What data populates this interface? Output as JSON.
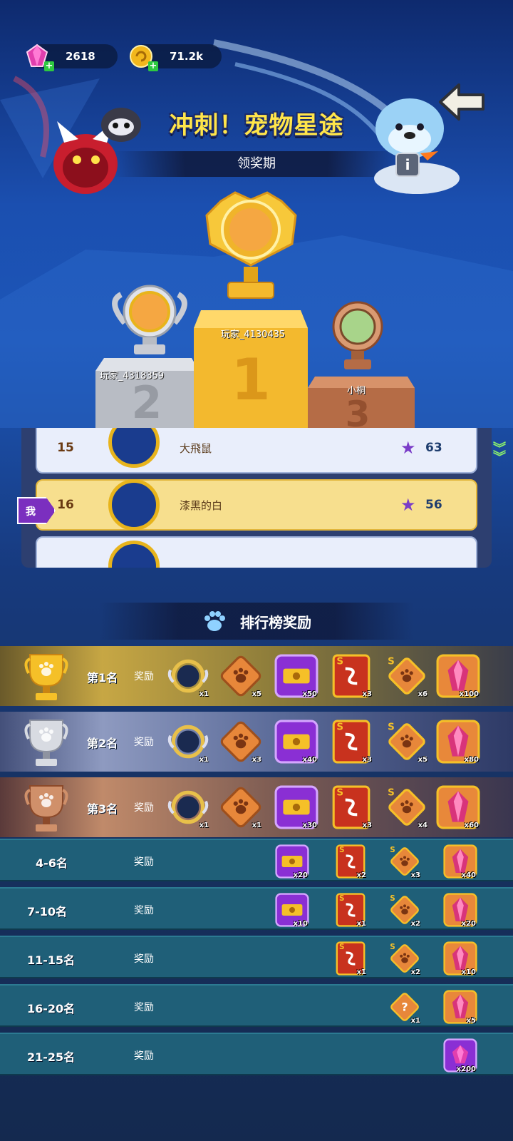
{
  "currencies": [
    {
      "name": "gem",
      "value": "2618"
    },
    {
      "name": "coin",
      "value": "71.2k"
    }
  ],
  "event": {
    "title": "冲刺！宠物星途",
    "phase": "领奖期"
  },
  "podium": [
    {
      "place": "1",
      "player": "玩家_4130435"
    },
    {
      "place": "2",
      "player": "玩家_4318359"
    },
    {
      "place": "3",
      "player": "小桐"
    }
  ],
  "ranking": [
    {
      "rank": "15",
      "name": "大飛鼠",
      "score": "63"
    },
    {
      "rank": "16",
      "name": "漆黑的白",
      "score": "56",
      "me": true
    }
  ],
  "me_tag": "我",
  "rewards_title": "排行榜奖励",
  "reward_label": "奖励",
  "reward_tiers": [
    {
      "rank": "第1名",
      "items": [
        {
          "icon": "frame-icon",
          "qty": "x1"
        },
        {
          "icon": "paw-token-icon",
          "qty": "x5"
        },
        {
          "icon": "ticket-icon",
          "qty": "x50"
        },
        {
          "icon": "s-card-icon",
          "qty": "x3"
        },
        {
          "icon": "s-paw-icon",
          "qty": "x6"
        },
        {
          "icon": "crystal-icon",
          "qty": "x100"
        }
      ]
    },
    {
      "rank": "第2名",
      "items": [
        {
          "icon": "frame-icon",
          "qty": "x1"
        },
        {
          "icon": "paw-token-icon",
          "qty": "x3"
        },
        {
          "icon": "ticket-icon",
          "qty": "x40"
        },
        {
          "icon": "s-card-icon",
          "qty": "x3"
        },
        {
          "icon": "s-paw-icon",
          "qty": "x5"
        },
        {
          "icon": "crystal-icon",
          "qty": "x80"
        }
      ]
    },
    {
      "rank": "第3名",
      "items": [
        {
          "icon": "frame-icon",
          "qty": "x1"
        },
        {
          "icon": "paw-token-icon",
          "qty": "x1"
        },
        {
          "icon": "ticket-icon",
          "qty": "x30"
        },
        {
          "icon": "s-card-icon",
          "qty": "x3"
        },
        {
          "icon": "s-paw-icon",
          "qty": "x4"
        },
        {
          "icon": "crystal-icon",
          "qty": "x60"
        }
      ]
    },
    {
      "rank": "4-6名",
      "items": [
        {
          "icon": "ticket-icon",
          "qty": "x20"
        },
        {
          "icon": "s-card-icon",
          "qty": "x2"
        },
        {
          "icon": "s-paw-icon",
          "qty": "x3"
        },
        {
          "icon": "crystal-icon",
          "qty": "x40"
        }
      ]
    },
    {
      "rank": "7-10名",
      "items": [
        {
          "icon": "ticket-icon",
          "qty": "x10"
        },
        {
          "icon": "s-card-icon",
          "qty": "x1"
        },
        {
          "icon": "s-paw-icon",
          "qty": "x2"
        },
        {
          "icon": "crystal-icon",
          "qty": "x20"
        }
      ]
    },
    {
      "rank": "11-15名",
      "items": [
        {
          "icon": "s-card-icon",
          "qty": "x1"
        },
        {
          "icon": "s-paw-icon",
          "qty": "x2"
        },
        {
          "icon": "crystal-icon",
          "qty": "x10"
        }
      ]
    },
    {
      "rank": "16-20名",
      "items": [
        {
          "icon": "mystery-icon",
          "qty": "x1"
        },
        {
          "icon": "crystal-icon",
          "qty": "x5"
        }
      ]
    },
    {
      "rank": "21-25名",
      "items": [
        {
          "icon": "gem-icon",
          "qty": "x200"
        }
      ]
    }
  ]
}
